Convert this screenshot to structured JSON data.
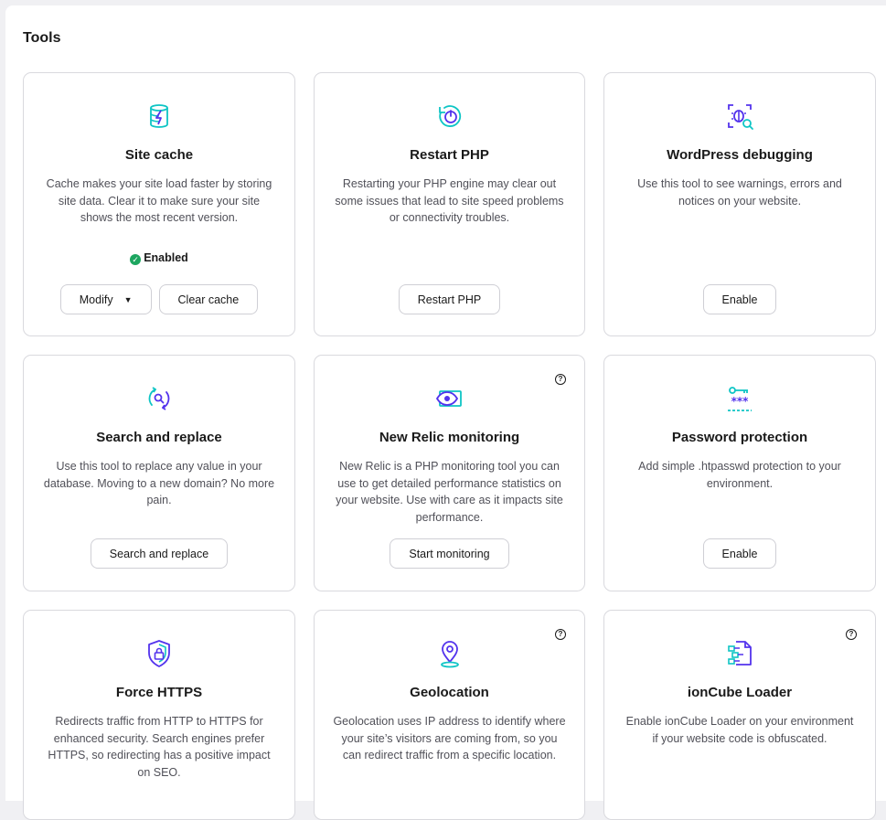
{
  "page": {
    "title": "Tools"
  },
  "cards": {
    "site_cache": {
      "icon": "database-lightning-icon",
      "title": "Site cache",
      "description": "Cache makes your site load faster by storing site data. Clear it to make sure your site shows the most recent version.",
      "status": "Enabled",
      "buttons": [
        "Modify",
        "Clear cache"
      ]
    },
    "restart_php": {
      "icon": "power-restart-icon",
      "title": "Restart PHP",
      "description": "Restarting your PHP engine may clear out some issues that lead to site speed problems or connectivity troubles.",
      "button": "Restart PHP"
    },
    "wp_debugging": {
      "icon": "bug-search-icon",
      "title": "WordPress debugging",
      "description": "Use this tool to see warnings, errors and notices on your website.",
      "button": "Enable"
    },
    "search_replace": {
      "icon": "search-replace-icon",
      "title": "Search and replace",
      "description": "Use this tool to replace any value in your database. Moving to a new domain? No more pain.",
      "button": "Search and replace"
    },
    "new_relic": {
      "icon": "eye-monitor-icon",
      "title": "New Relic monitoring",
      "description": "New Relic is a PHP monitoring tool you can use to get detailed performance statistics on your website. Use with care as it impacts site performance.",
      "button": "Start monitoring",
      "help": "?"
    },
    "password_protection": {
      "icon": "key-password-icon",
      "title": "Password protection",
      "description": "Add simple .htpasswd protection to your environment.",
      "button": "Enable"
    },
    "force_https": {
      "icon": "shield-lock-icon",
      "title": "Force HTTPS",
      "description": "Redirects traffic from HTTP to HTTPS for enhanced security. Search engines prefer HTTPS, so redirecting has a positive impact on SEO."
    },
    "geolocation": {
      "icon": "location-pin-icon",
      "title": "Geolocation",
      "description": "Geolocation uses IP address to identify where your site’s visitors are coming from, so you can redirect traffic from a specific location.",
      "help": "?"
    },
    "ioncube": {
      "icon": "ioncube-file-icon",
      "title": "ionCube Loader",
      "description": "Enable ionCube Loader on your environment if your website code is obfuscated.",
      "help": "?"
    }
  },
  "colors": {
    "accent_purple": "#5333ed",
    "accent_teal": "#0ec5c5",
    "success_green": "#1da660"
  }
}
